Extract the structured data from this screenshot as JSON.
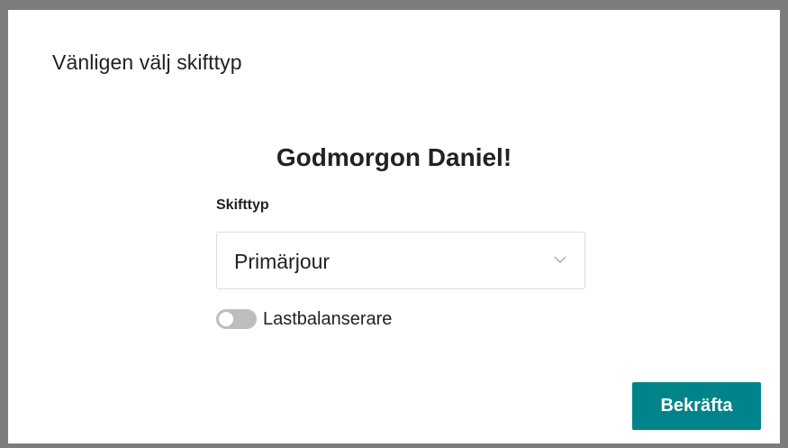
{
  "modal": {
    "title": "Vänligen välj skifttyp",
    "greeting": "Godmorgon Daniel!"
  },
  "shift_type": {
    "label": "Skifttyp",
    "selected_value": "Primärjour",
    "chevron_icon": "chevron-down-icon"
  },
  "load_balancer": {
    "label": "Lastbalanserare",
    "enabled": false
  },
  "actions": {
    "confirm_label": "Bekräfta"
  },
  "colors": {
    "overlay": "#7d7d7d",
    "modal_background": "#ffffff",
    "primary_button": "#00848a",
    "toggle_off": "#bdbdbd",
    "text": "#222222"
  }
}
